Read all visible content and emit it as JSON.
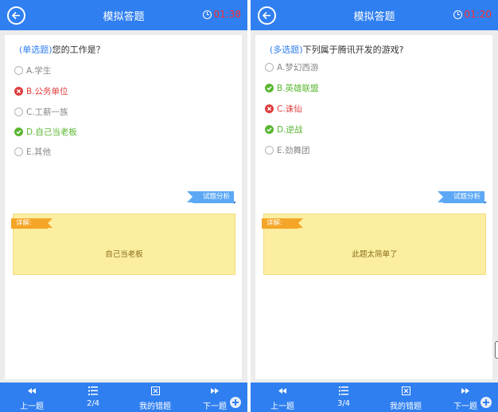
{
  "colors": {
    "header": "#2f7ff0",
    "timer": "#ff2a2a",
    "wrong": "#e03a3a",
    "right": "#5ab631",
    "analysis_tag": "#5ca8f5",
    "detail_bg": "#fbeea1",
    "detail_tag": "#f5a527"
  },
  "screens": [
    {
      "header": {
        "title": "模拟答题",
        "timer": "01:38"
      },
      "question": {
        "type": "(单选题)",
        "text": "您的工作是？"
      },
      "options": [
        {
          "label": "A.学生",
          "state": "none"
        },
        {
          "label": "B.公务单位",
          "state": "wrong"
        },
        {
          "label": "C.工薪一族",
          "state": "none"
        },
        {
          "label": "D.自己当老板",
          "state": "right"
        },
        {
          "label": "E.其他",
          "state": "none"
        }
      ],
      "analysis_tag": "试题分析",
      "detail": {
        "tag": "详解:",
        "text": "自己当老板"
      },
      "footer": {
        "prev": "上一题",
        "page": "2/4",
        "wrong_book": "我的错题",
        "next": "下一题"
      }
    },
    {
      "header": {
        "title": "模拟答题",
        "timer": "01:20"
      },
      "question": {
        "type": "(多选题)",
        "text": "下列属于腾讯开发的游戏?"
      },
      "options": [
        {
          "label": "A.梦幻西游",
          "state": "none"
        },
        {
          "label": "B.英雄联盟",
          "state": "right"
        },
        {
          "label": "C.诛仙",
          "state": "wrong"
        },
        {
          "label": "D.逆战",
          "state": "right"
        },
        {
          "label": "E.劲舞团",
          "state": "none"
        }
      ],
      "analysis_tag": "试题分析",
      "detail": {
        "tag": "详解:",
        "text": "此题太简单了"
      },
      "footer": {
        "prev": "上一题",
        "page": "3/4",
        "wrong_book": "我的错题",
        "next": "下一题"
      }
    }
  ]
}
